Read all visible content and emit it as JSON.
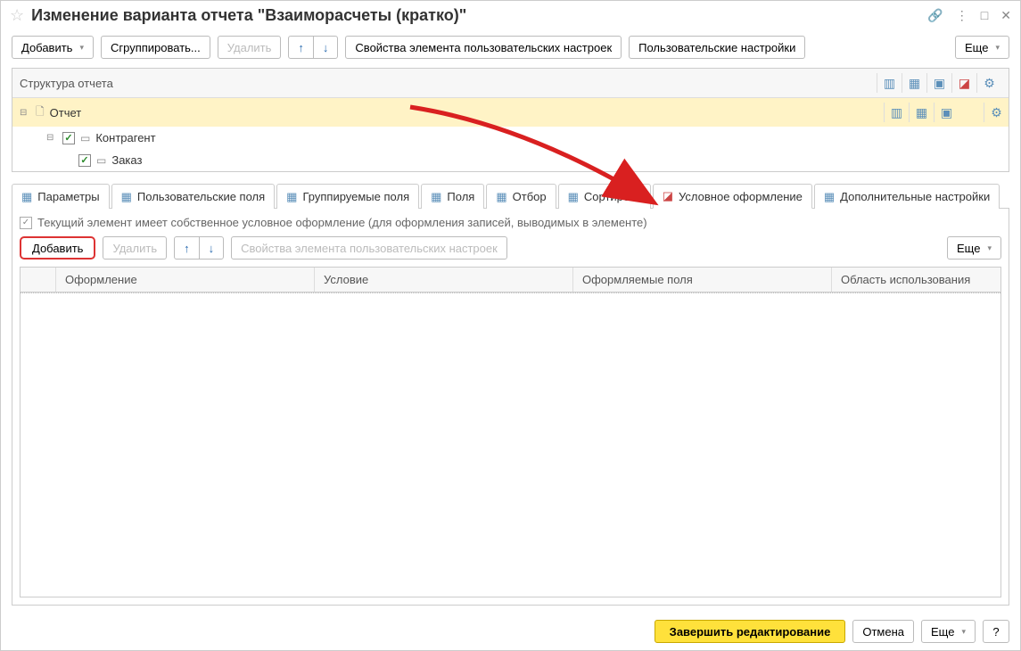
{
  "title": "Изменение варианта отчета \"Взаиморасчеты (кратко)\"",
  "toolbar": {
    "add": "Добавить",
    "group": "Сгруппировать...",
    "delete": "Удалить",
    "props": "Свойства элемента пользовательских настроек",
    "user_settings": "Пользовательские настройки",
    "more": "Еще"
  },
  "structure": {
    "header": "Структура отчета",
    "root": "Отчет",
    "children": [
      {
        "label": "Контрагент"
      },
      {
        "label": "Заказ"
      }
    ]
  },
  "tabs": [
    {
      "label": "Параметры"
    },
    {
      "label": "Пользовательские поля"
    },
    {
      "label": "Группируемые поля"
    },
    {
      "label": "Поля"
    },
    {
      "label": "Отбор"
    },
    {
      "label": "Сортировк"
    },
    {
      "label": "Условное оформление"
    },
    {
      "label": "Дополнительные настройки"
    }
  ],
  "cond_format": {
    "checkbox_label": "Текущий элемент имеет собственное условное оформление (для оформления записей, выводимых в элементе)",
    "add": "Добавить",
    "delete": "Удалить",
    "props": "Свойства элемента пользовательских настроек",
    "more": "Еще",
    "columns": {
      "format": "Оформление",
      "condition": "Условие",
      "fields": "Оформляемые поля",
      "scope": "Область использования"
    }
  },
  "footer": {
    "finish": "Завершить редактирование",
    "cancel": "Отмена",
    "more": "Еще",
    "help": "?"
  }
}
